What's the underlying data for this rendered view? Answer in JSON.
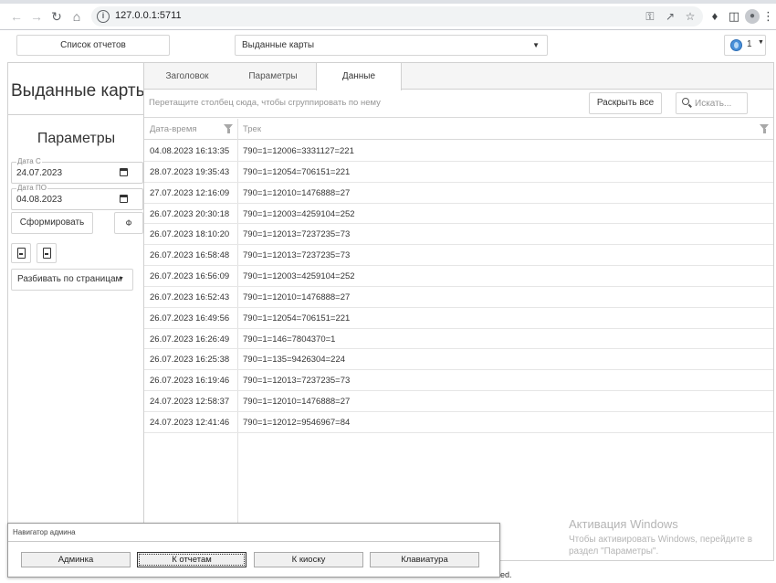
{
  "browser": {
    "url": "127.0.0.1:5711"
  },
  "topbar": {
    "reports_button": "Список отчетов",
    "report_selected": "Выданные карты",
    "lang_number": "1"
  },
  "left_panel": {
    "report_title": "Выданные карты",
    "params_title": "Параметры",
    "date_from_label": "Дата С",
    "date_from_value": "24.07.2023",
    "date_to_label": "Дата ПО",
    "date_to_value": "04.08.2023",
    "generate_button": "Сформировать",
    "refresh_glyph": "Ф",
    "paging_selected": "Разбивать по страницам"
  },
  "main": {
    "tabs": [
      {
        "label": "Заголовок",
        "active": false
      },
      {
        "label": "Параметры",
        "active": false
      },
      {
        "label": "Данные",
        "active": true
      }
    ],
    "group_hint": "Перетащите столбец сюда, чтобы сгруппировать по нему",
    "expand_all_button": "Раскрыть все",
    "search_placeholder": "Искать...",
    "columns": [
      "Дата-время",
      "Трек"
    ],
    "rows": [
      [
        "04.08.2023 16:13:35",
        "790=1=12006=3331127=221"
      ],
      [
        "28.07.2023 19:35:43",
        "790=1=12054=706151=221"
      ],
      [
        "27.07.2023 12:16:09",
        "790=1=12010=1476888=27"
      ],
      [
        "26.07.2023 20:30:18",
        "790=1=12003=4259104=252"
      ],
      [
        "26.07.2023 18:10:20",
        "790=1=12013=7237235=73"
      ],
      [
        "26.07.2023 16:58:48",
        "790=1=12013=7237235=73"
      ],
      [
        "26.07.2023 16:56:09",
        "790=1=12003=4259104=252"
      ],
      [
        "26.07.2023 16:52:43",
        "790=1=12010=1476888=27"
      ],
      [
        "26.07.2023 16:49:56",
        "790=1=12054=706151=221"
      ],
      [
        "26.07.2023 16:26:49",
        "790=1=146=7804370=1"
      ],
      [
        "26.07.2023 16:25:38",
        "790=1=135=9426304=224"
      ],
      [
        "26.07.2023 16:19:46",
        "790=1=12013=7237235=73"
      ],
      [
        "24.07.2023 12:58:37",
        "790=1=12010=1476888=27"
      ],
      [
        "24.07.2023 12:41:46",
        "790=1=12012=9546967=84"
      ]
    ]
  },
  "watermark": {
    "line1": "Активация Windows",
    "line2": "Чтобы активировать Windows, перейдите в",
    "line3": "раздел \"Параметры\"."
  },
  "footer": {
    "visible_fragment": "ed."
  },
  "navigator": {
    "title": "Навигатор админа",
    "buttons": [
      "Админка",
      "К отчетам",
      "К киоску",
      "Клавиатура"
    ]
  }
}
